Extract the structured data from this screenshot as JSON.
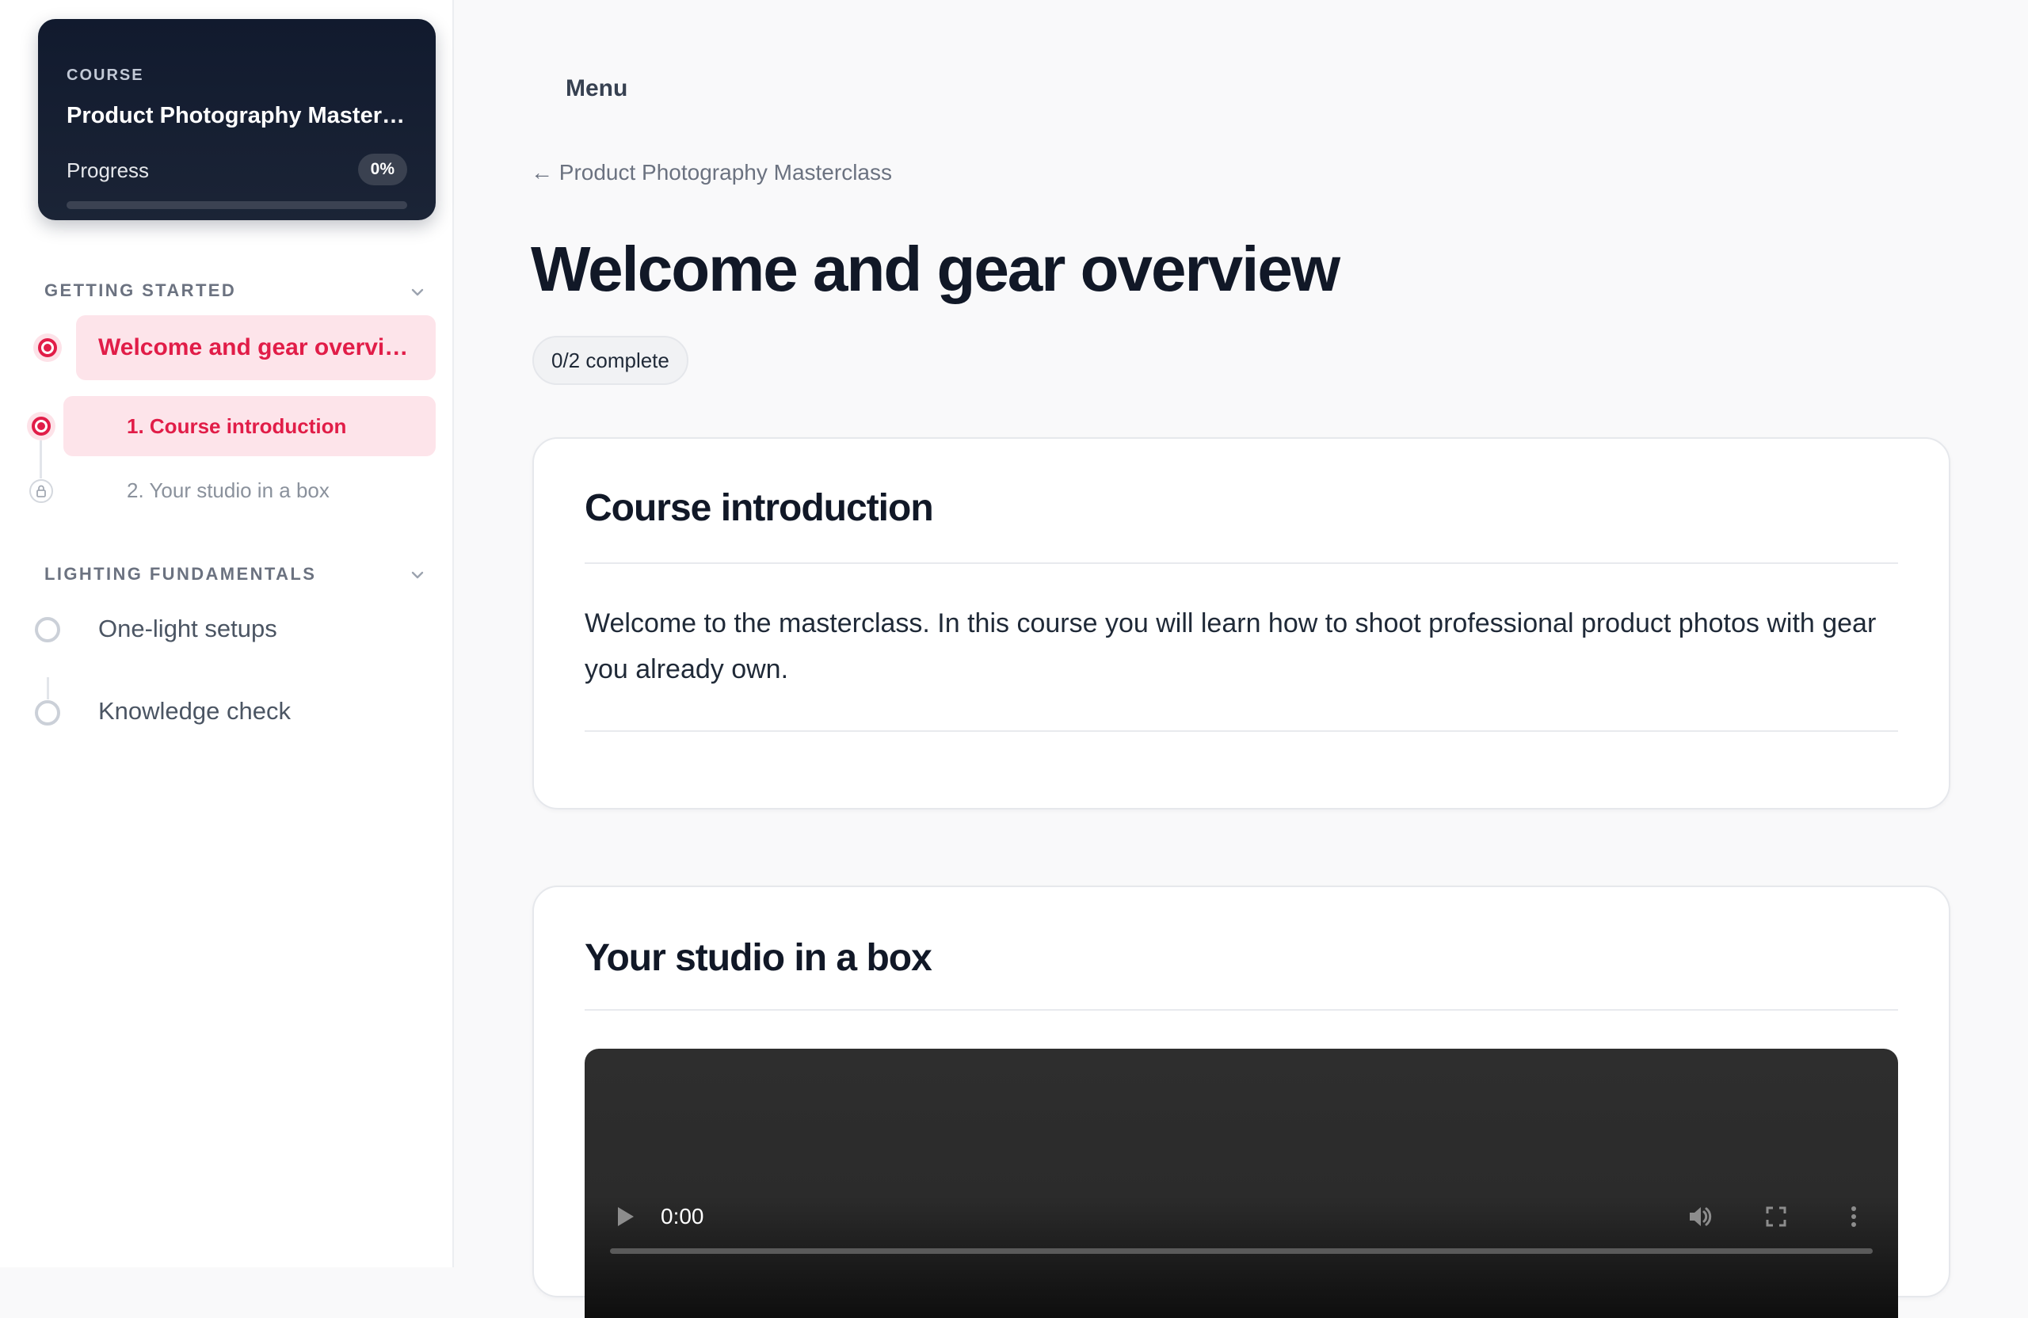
{
  "sidebar": {
    "course_card": {
      "label": "COURSE",
      "title": "Product Photography Masterclass",
      "progress_label": "Progress",
      "progress_percent": "0%",
      "progress_fraction": 0
    },
    "sections": [
      {
        "title": "GETTING STARTED",
        "lessons": [
          {
            "title": "Welcome and gear overview",
            "state": "current",
            "steps": [
              {
                "label": "1. Course introduction",
                "state": "current"
              },
              {
                "label": "2. Your studio in a box",
                "state": "locked"
              }
            ]
          }
        ]
      },
      {
        "title": "LIGHTING FUNDAMENTALS",
        "lessons": [
          {
            "title": "One-light setups",
            "state": "not-started"
          },
          {
            "title": "Knowledge check",
            "state": "not-started"
          }
        ]
      }
    ]
  },
  "main": {
    "menu_label": "Menu",
    "back_link": "← Product Photography Masterclass",
    "title": "Welcome and gear overview",
    "completion": "0/2 complete",
    "cards": [
      {
        "title": "Course introduction",
        "body": "Welcome to the masterclass. In this course you will learn how to shoot professional product photos with gear you already own."
      },
      {
        "title": "Your studio in a box",
        "video": {
          "time": "0:00"
        }
      }
    ]
  },
  "colors": {
    "accent": "#e11d48",
    "accent_soft": "#fde4ea",
    "course_card_bg": "#111a2e",
    "page_bg": "#f9f9fa"
  }
}
